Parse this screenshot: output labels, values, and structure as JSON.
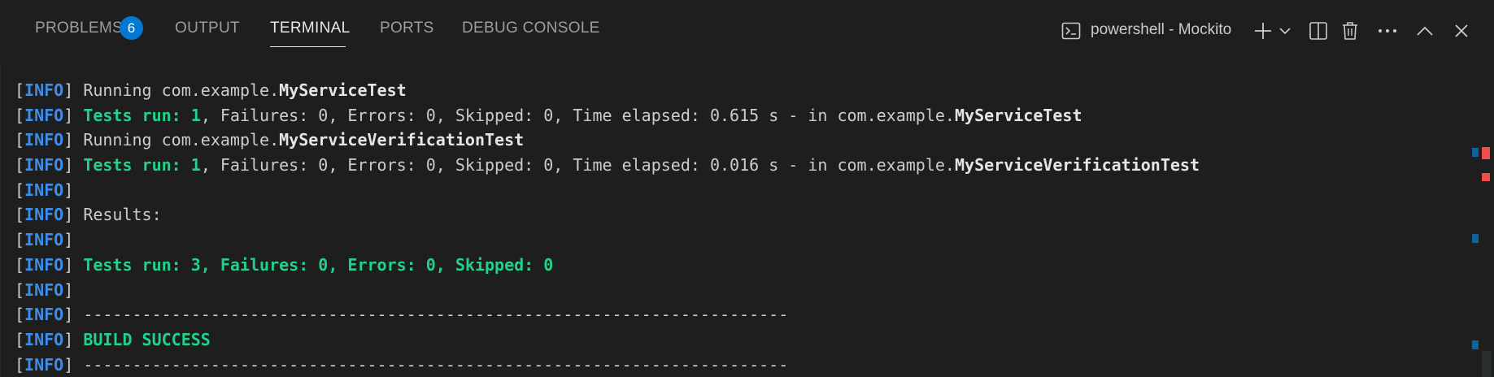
{
  "tabs": [
    {
      "label": "PROBLEMS",
      "badge": "6"
    },
    {
      "label": "OUTPUT"
    },
    {
      "label": "TERMINAL"
    },
    {
      "label": "PORTS"
    },
    {
      "label": "DEBUG CONSOLE"
    }
  ],
  "terminal_instance": {
    "label": "powershell - Mockito"
  },
  "toolbar_icons": [
    "terminal-icon",
    "add-icon",
    "chevron-down-icon",
    "split-icon",
    "trash-icon",
    "more-icon",
    "maximize-icon",
    "close-icon"
  ],
  "terminal": {
    "lines": [
      {
        "prefix": "INFO",
        "plain": "Running com.example.",
        "bold": "MyServiceTest"
      },
      {
        "prefix": "INFO",
        "green": "Tests run: 1",
        "plain": ", Failures: 0, Errors: 0, Skipped: 0, Time elapsed: 0.615 s - in com.example.",
        "bold": "MyServiceTest"
      },
      {
        "prefix": "INFO",
        "plain": "Running com.example.",
        "bold": "MyServiceVerificationTest"
      },
      {
        "prefix": "INFO",
        "green": "Tests run: 1",
        "plain": ", Failures: 0, Errors: 0, Skipped: 0, Time elapsed: 0.016 s - in com.example.",
        "bold": "MyServiceVerificationTest"
      },
      {
        "prefix": "INFO",
        "plain": ""
      },
      {
        "prefix": "INFO",
        "plain": "Results:"
      },
      {
        "prefix": "INFO",
        "plain": ""
      },
      {
        "prefix": "INFO",
        "green": "Tests run: 3, Failures: 0, Errors: 0, Skipped: 0"
      },
      {
        "prefix": "INFO",
        "plain": ""
      },
      {
        "prefix": "INFO",
        "plain": "------------------------------------------------------------------------"
      },
      {
        "prefix": "INFO",
        "green": "BUILD SUCCESS"
      },
      {
        "prefix": "INFO",
        "plain": "------------------------------------------------------------------------"
      }
    ]
  },
  "colors": {
    "background": "#1e1e1e",
    "info": "#3b8eea",
    "success": "#23d18b",
    "badge": "#0078d4",
    "marker_blue": "#0e639c",
    "marker_red": "#f14c4c"
  }
}
